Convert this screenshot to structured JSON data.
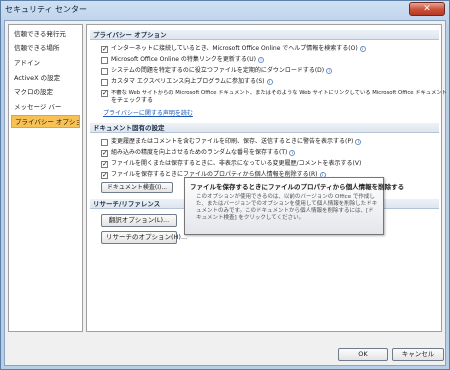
{
  "window": {
    "title": "セキュリティ センター"
  },
  "sidebar": {
    "items": [
      {
        "label": "信頼できる発行元"
      },
      {
        "label": "信頼できる場所"
      },
      {
        "label": "アドイン"
      },
      {
        "label": "ActiveX の設定"
      },
      {
        "label": "マクロの設定"
      },
      {
        "label": "メッセージ バー"
      },
      {
        "label": "プライバシー オプション",
        "active": true
      }
    ]
  },
  "privacy": {
    "heading": "プライバシー オプション",
    "options": [
      {
        "label": "インターネットに接続しているとき、Microsoft Office Online でヘルプ情報を検索する(O)",
        "checked": true,
        "help": true
      },
      {
        "label": "Microsoft Office Online の特集リンクを更新する(U)",
        "checked": false,
        "help": true
      },
      {
        "label": "システムの問題を特定するのに役立つファイルを定期的にダウンロードする(D)",
        "checked": false,
        "help": true
      },
      {
        "label": "カスタマ エクスペリエンス向上プログラムに参加する(S)",
        "checked": false,
        "help": true
      },
      {
        "label": "不審な Web サイトからの Microsoft Office ドキュメント、またはそのような Web サイトにリンクしている Microsoft Office ドキュメント",
        "label2": "をチェックする",
        "checked": true,
        "help": false
      }
    ],
    "statement_link": "プライバシーに関する声明を読む"
  },
  "docoptions": {
    "heading": "ドキュメント固有の設定",
    "options": [
      {
        "label": "変更履歴またはコメントを含むファイルを印刷、保存、送信するときに警告を表示する(P)",
        "checked": false,
        "help": true
      },
      {
        "label": "組み込みの精度を向上させるためのランダムな番号を保存する(T)",
        "checked": true,
        "help": true
      },
      {
        "label": "ファイルを開くまたは保存するときに、非表示になっている変更履歴/コメントを表示する(V)",
        "checked": true,
        "help": false
      },
      {
        "label": "ファイルを保存するときにファイルのプロパティから個人情報を削除する(R)",
        "checked": true,
        "help": true
      }
    ],
    "inspect_button": "ドキュメント検査(I)..."
  },
  "research": {
    "heading": "リサーチ/リファレンス",
    "translate_button": "翻訳オプション(L)...",
    "research_button": "リサーチのオプション(H)..."
  },
  "tooltip": {
    "title": "ファイルを保存するときにファイルのプロパティから個人情報を削除する",
    "body": "このオプションが使用できるのは、以前のバージョンの Office で作成した、またはバージョンでのオプションを使用して個人情報を削除したドキュメントのみです。このドキュメントから個人情報を削除するには、[ドキュメント検査] をクリックしてください。"
  },
  "footer": {
    "ok": "OK",
    "cancel": "キャンセル"
  },
  "colors": {
    "accent": "#f8c154",
    "link": "#1b56b4"
  }
}
